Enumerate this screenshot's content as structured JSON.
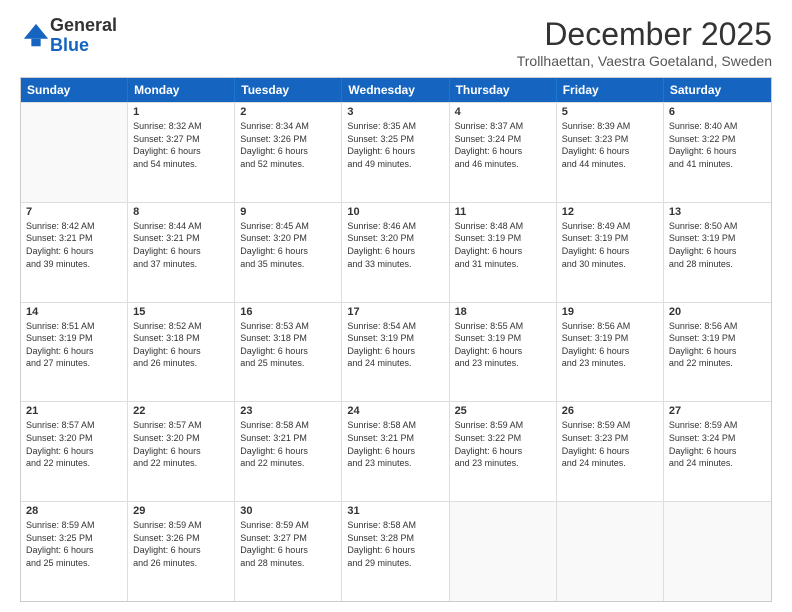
{
  "logo": {
    "general": "General",
    "blue": "Blue"
  },
  "title": "December 2025",
  "subtitle": "Trollhaettan, Vaestra Goetaland, Sweden",
  "header_days": [
    "Sunday",
    "Monday",
    "Tuesday",
    "Wednesday",
    "Thursday",
    "Friday",
    "Saturday"
  ],
  "rows": [
    [
      {
        "day": "",
        "info": ""
      },
      {
        "day": "1",
        "info": "Sunrise: 8:32 AM\nSunset: 3:27 PM\nDaylight: 6 hours\nand 54 minutes."
      },
      {
        "day": "2",
        "info": "Sunrise: 8:34 AM\nSunset: 3:26 PM\nDaylight: 6 hours\nand 52 minutes."
      },
      {
        "day": "3",
        "info": "Sunrise: 8:35 AM\nSunset: 3:25 PM\nDaylight: 6 hours\nand 49 minutes."
      },
      {
        "day": "4",
        "info": "Sunrise: 8:37 AM\nSunset: 3:24 PM\nDaylight: 6 hours\nand 46 minutes."
      },
      {
        "day": "5",
        "info": "Sunrise: 8:39 AM\nSunset: 3:23 PM\nDaylight: 6 hours\nand 44 minutes."
      },
      {
        "day": "6",
        "info": "Sunrise: 8:40 AM\nSunset: 3:22 PM\nDaylight: 6 hours\nand 41 minutes."
      }
    ],
    [
      {
        "day": "7",
        "info": "Sunrise: 8:42 AM\nSunset: 3:21 PM\nDaylight: 6 hours\nand 39 minutes."
      },
      {
        "day": "8",
        "info": "Sunrise: 8:44 AM\nSunset: 3:21 PM\nDaylight: 6 hours\nand 37 minutes."
      },
      {
        "day": "9",
        "info": "Sunrise: 8:45 AM\nSunset: 3:20 PM\nDaylight: 6 hours\nand 35 minutes."
      },
      {
        "day": "10",
        "info": "Sunrise: 8:46 AM\nSunset: 3:20 PM\nDaylight: 6 hours\nand 33 minutes."
      },
      {
        "day": "11",
        "info": "Sunrise: 8:48 AM\nSunset: 3:19 PM\nDaylight: 6 hours\nand 31 minutes."
      },
      {
        "day": "12",
        "info": "Sunrise: 8:49 AM\nSunset: 3:19 PM\nDaylight: 6 hours\nand 30 minutes."
      },
      {
        "day": "13",
        "info": "Sunrise: 8:50 AM\nSunset: 3:19 PM\nDaylight: 6 hours\nand 28 minutes."
      }
    ],
    [
      {
        "day": "14",
        "info": "Sunrise: 8:51 AM\nSunset: 3:19 PM\nDaylight: 6 hours\nand 27 minutes."
      },
      {
        "day": "15",
        "info": "Sunrise: 8:52 AM\nSunset: 3:18 PM\nDaylight: 6 hours\nand 26 minutes."
      },
      {
        "day": "16",
        "info": "Sunrise: 8:53 AM\nSunset: 3:18 PM\nDaylight: 6 hours\nand 25 minutes."
      },
      {
        "day": "17",
        "info": "Sunrise: 8:54 AM\nSunset: 3:19 PM\nDaylight: 6 hours\nand 24 minutes."
      },
      {
        "day": "18",
        "info": "Sunrise: 8:55 AM\nSunset: 3:19 PM\nDaylight: 6 hours\nand 23 minutes."
      },
      {
        "day": "19",
        "info": "Sunrise: 8:56 AM\nSunset: 3:19 PM\nDaylight: 6 hours\nand 23 minutes."
      },
      {
        "day": "20",
        "info": "Sunrise: 8:56 AM\nSunset: 3:19 PM\nDaylight: 6 hours\nand 22 minutes."
      }
    ],
    [
      {
        "day": "21",
        "info": "Sunrise: 8:57 AM\nSunset: 3:20 PM\nDaylight: 6 hours\nand 22 minutes."
      },
      {
        "day": "22",
        "info": "Sunrise: 8:57 AM\nSunset: 3:20 PM\nDaylight: 6 hours\nand 22 minutes."
      },
      {
        "day": "23",
        "info": "Sunrise: 8:58 AM\nSunset: 3:21 PM\nDaylight: 6 hours\nand 22 minutes."
      },
      {
        "day": "24",
        "info": "Sunrise: 8:58 AM\nSunset: 3:21 PM\nDaylight: 6 hours\nand 23 minutes."
      },
      {
        "day": "25",
        "info": "Sunrise: 8:59 AM\nSunset: 3:22 PM\nDaylight: 6 hours\nand 23 minutes."
      },
      {
        "day": "26",
        "info": "Sunrise: 8:59 AM\nSunset: 3:23 PM\nDaylight: 6 hours\nand 24 minutes."
      },
      {
        "day": "27",
        "info": "Sunrise: 8:59 AM\nSunset: 3:24 PM\nDaylight: 6 hours\nand 24 minutes."
      }
    ],
    [
      {
        "day": "28",
        "info": "Sunrise: 8:59 AM\nSunset: 3:25 PM\nDaylight: 6 hours\nand 25 minutes."
      },
      {
        "day": "29",
        "info": "Sunrise: 8:59 AM\nSunset: 3:26 PM\nDaylight: 6 hours\nand 26 minutes."
      },
      {
        "day": "30",
        "info": "Sunrise: 8:59 AM\nSunset: 3:27 PM\nDaylight: 6 hours\nand 28 minutes."
      },
      {
        "day": "31",
        "info": "Sunrise: 8:58 AM\nSunset: 3:28 PM\nDaylight: 6 hours\nand 29 minutes."
      },
      {
        "day": "",
        "info": ""
      },
      {
        "day": "",
        "info": ""
      },
      {
        "day": "",
        "info": ""
      }
    ]
  ]
}
